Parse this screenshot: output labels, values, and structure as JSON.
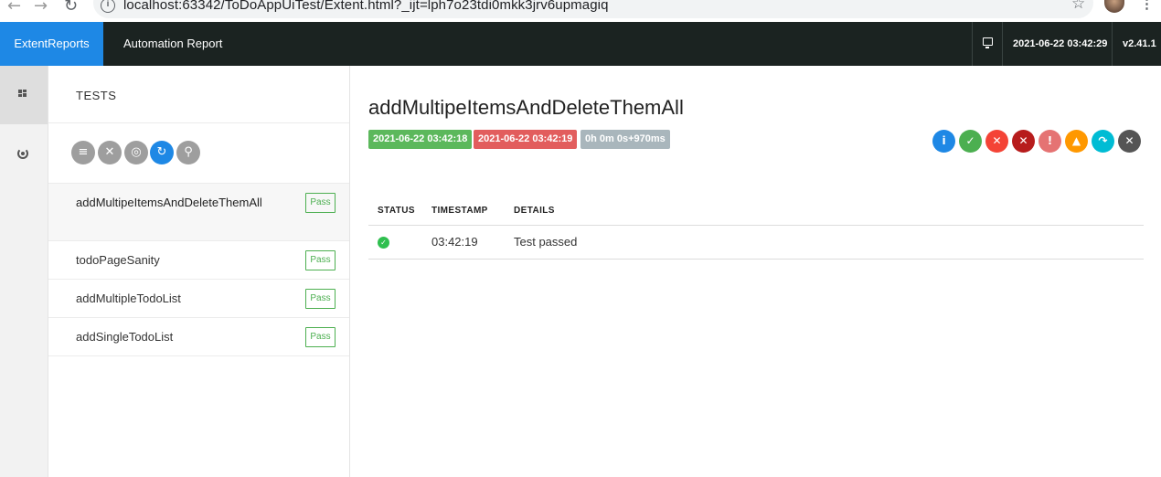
{
  "browser": {
    "url": "localhost:63342/ToDoAppUiTest/Extent.html?_ijt=lph7o23tdi0mkk3jrv6upmagiq",
    "back_icon": "arrow-left-icon",
    "forward_icon": "arrow-right-icon",
    "reload_icon": "reload-icon",
    "star_icon": "star-icon"
  },
  "header": {
    "brand": "ExtentReports",
    "report_name": "Automation Report",
    "date": "2021-06-22 03:42:29",
    "version": "v2.41.1",
    "brand_color": "#1e88e5",
    "bar_color": "#1b2321"
  },
  "sidebar": {
    "items": [
      {
        "icon": "dashboard-grid-icon",
        "active": true
      },
      {
        "icon": "dashboard-gauge-icon",
        "active": false
      }
    ]
  },
  "tests_panel": {
    "title": "TESTS",
    "toolbar": [
      {
        "icon": "list-icon",
        "glyph": "≡"
      },
      {
        "icon": "close-icon",
        "glyph": "✕"
      },
      {
        "icon": "gauge-icon",
        "glyph": "◎"
      },
      {
        "icon": "refresh-icon",
        "glyph": "↻"
      },
      {
        "icon": "search-icon",
        "glyph": "⚲"
      }
    ],
    "tests": [
      {
        "name": "addMultipeItemsAndDeleteThemAll",
        "status": "Pass"
      },
      {
        "name": "todoPageSanity",
        "status": "Pass"
      },
      {
        "name": "addMultipleTodoList",
        "status": "Pass"
      },
      {
        "name": "addSingleTodoList",
        "status": "Pass"
      }
    ]
  },
  "detail": {
    "title": "addMultipeItemsAndDeleteThemAll",
    "start_time": "2021-06-22 03:42:18",
    "end_time": "2021-06-22 03:42:19",
    "duration": "0h 0m 0s+970ms",
    "status_filters": [
      {
        "icon": "info-icon",
        "glyph": "i",
        "color": "#1e88e5"
      },
      {
        "icon": "pass-icon",
        "glyph": "✓",
        "color": "#4caf50"
      },
      {
        "icon": "fail-icon",
        "glyph": "✕",
        "color": "#f44336"
      },
      {
        "icon": "fatal-icon",
        "glyph": "✕",
        "color": "#b71c1c"
      },
      {
        "icon": "error-icon",
        "glyph": "!",
        "color": "#e57373"
      },
      {
        "icon": "warning-icon",
        "glyph": "▲",
        "color": "#ff9800"
      },
      {
        "icon": "skip-icon",
        "glyph": "↷",
        "color": "#00bcd4"
      },
      {
        "icon": "unknown-icon",
        "glyph": "✕",
        "color": "#555555"
      }
    ],
    "table": {
      "headers": [
        "STATUS",
        "TIMESTAMP",
        "DETAILS"
      ],
      "rows": [
        {
          "status": "pass",
          "timestamp": "03:42:19",
          "details": "Test passed"
        }
      ]
    }
  }
}
